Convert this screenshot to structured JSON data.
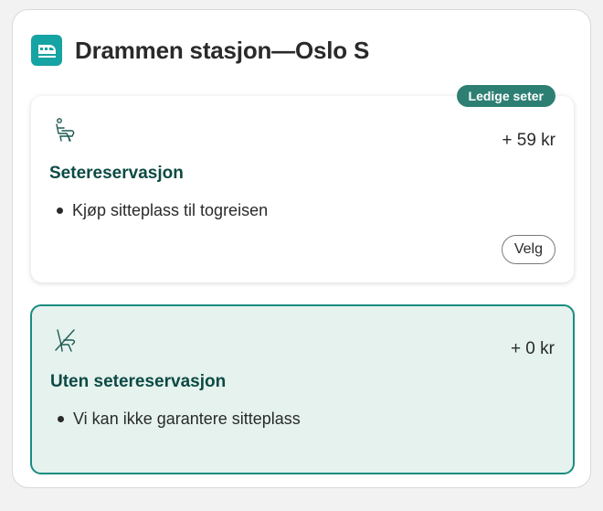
{
  "route": {
    "title": "Drammen stasjon—Oslo S",
    "icon": "train-icon",
    "accent_color": "#16a3a3"
  },
  "options": [
    {
      "badge": "Ledige seter",
      "price": "+ 59 kr",
      "title": "Setereservasjon",
      "bullets": [
        "Kjøp sitteplass til togreisen"
      ],
      "button_label": "Velg",
      "icon": "reserved-seat-icon",
      "selected": false
    },
    {
      "price": "+ 0 kr",
      "title": "Uten setereservasjon",
      "bullets": [
        "Vi kan ikke garantere sitteplass"
      ],
      "icon": "no-seat-icon",
      "selected": true,
      "selected_border_color": "#1a8c80",
      "selected_background_color": "#e5f2ee"
    }
  ],
  "colors": {
    "badge_background": "#2e7f73",
    "title_text": "#0c4a44"
  }
}
